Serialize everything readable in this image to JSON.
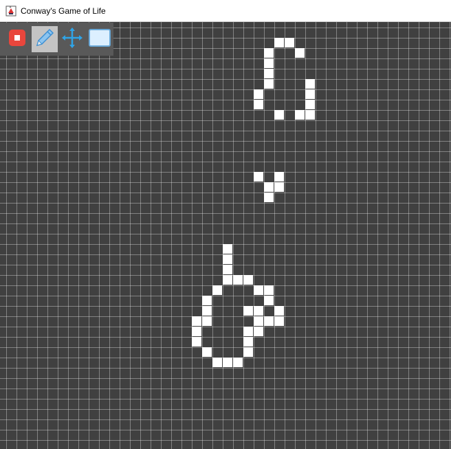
{
  "window": {
    "title": "Conway's Game of Life",
    "icon": "java-cup-icon"
  },
  "toolbar": {
    "tools": [
      {
        "name": "stop",
        "icon": "stop-icon",
        "selected": false
      },
      {
        "name": "draw",
        "icon": "pencil-icon",
        "selected": true
      },
      {
        "name": "pan",
        "icon": "move-arrows-icon",
        "selected": false
      },
      {
        "name": "select",
        "icon": "selection-rectangle-icon",
        "selected": false
      }
    ]
  },
  "board": {
    "cell_color": "#ffffff",
    "background_color": "#404040",
    "live_cells": [
      [
        26,
        1
      ],
      [
        27,
        1
      ],
      [
        25,
        2
      ],
      [
        28,
        2
      ],
      [
        25,
        3
      ],
      [
        25,
        4
      ],
      [
        25,
        5
      ],
      [
        29,
        5
      ],
      [
        24,
        6
      ],
      [
        29,
        6
      ],
      [
        24,
        7
      ],
      [
        29,
        7
      ],
      [
        26,
        8
      ],
      [
        28,
        8
      ],
      [
        29,
        8
      ],
      [
        24,
        14
      ],
      [
        26,
        14
      ],
      [
        25,
        15
      ],
      [
        26,
        15
      ],
      [
        25,
        16
      ],
      [
        21,
        21
      ],
      [
        21,
        22
      ],
      [
        21,
        23
      ],
      [
        21,
        24
      ],
      [
        22,
        24
      ],
      [
        23,
        24
      ],
      [
        20,
        25
      ],
      [
        24,
        25
      ],
      [
        25,
        25
      ],
      [
        19,
        26
      ],
      [
        25,
        26
      ],
      [
        19,
        27
      ],
      [
        23,
        27
      ],
      [
        24,
        27
      ],
      [
        26,
        27
      ],
      [
        18,
        28
      ],
      [
        19,
        28
      ],
      [
        24,
        28
      ],
      [
        25,
        28
      ],
      [
        26,
        28
      ],
      [
        18,
        29
      ],
      [
        23,
        29
      ],
      [
        24,
        29
      ],
      [
        18,
        30
      ],
      [
        23,
        30
      ],
      [
        19,
        31
      ],
      [
        23,
        31
      ],
      [
        20,
        32
      ],
      [
        21,
        32
      ],
      [
        22,
        32
      ]
    ]
  }
}
